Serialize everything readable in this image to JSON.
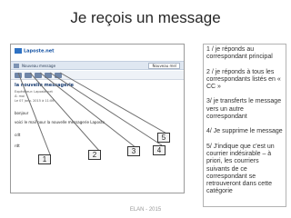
{
  "slide": {
    "title": "Je reçois un message",
    "footer": "ELAN - 2015"
  },
  "screenshot": {
    "logo_text": "Laposte.net",
    "toolbar_message": "Nouveau message",
    "toolbar_right": "Nouveau mel",
    "subject": "la nouvelle messagerie",
    "meta_lines": [
      "Expéditeur: Laposte.net",
      "À: moi",
      "Le 07 janv. 2015 à 11:06"
    ],
    "body_lines": [
      "bonjour",
      "voici le mail pour la nouvelle messagerie Laposte",
      "cdt",
      "rdt"
    ]
  },
  "callouts": [
    {
      "number": "1"
    },
    {
      "number": "2"
    },
    {
      "number": "3"
    },
    {
      "number": "4"
    },
    {
      "number": "5"
    }
  ],
  "instructions": [
    "1 / je réponds au correspondant principal",
    "2 / je réponds à tous les correspondants listés en « CC »",
    "3/ je transferts le message vers un autre correspondant",
    "4/ Je supprime le message",
    "5/ J'indique que c'est un courrier indésirable – à priori, les courriers suivants de ce correspondant se retrouveront dans cette catégorie"
  ]
}
